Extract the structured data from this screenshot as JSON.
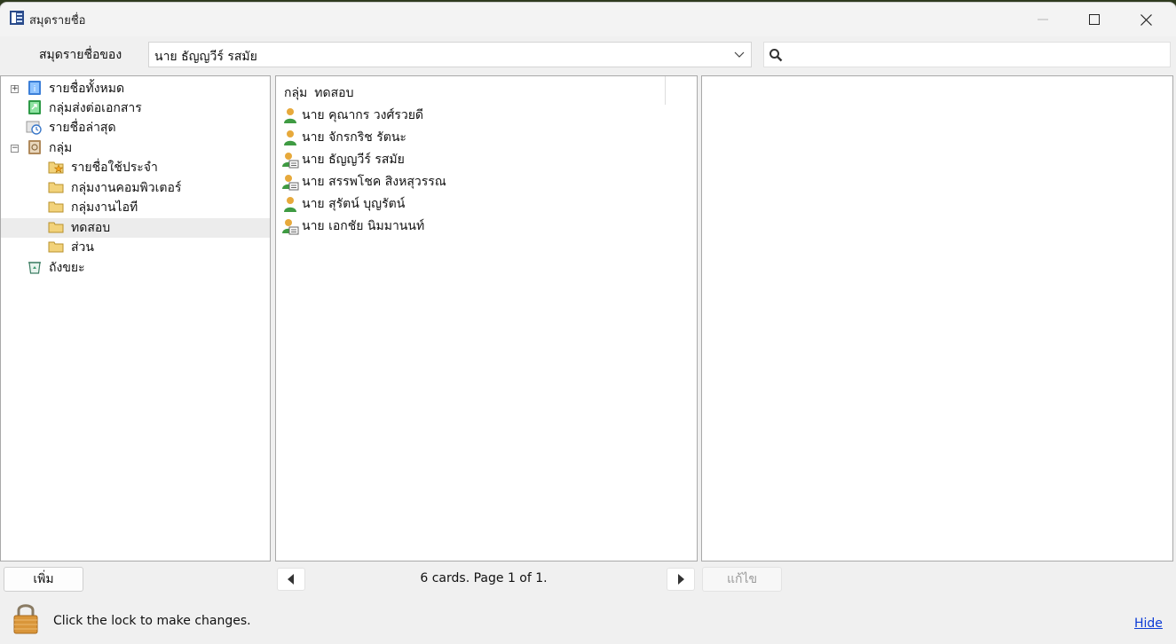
{
  "window": {
    "title": "สมุดรายชื่อ"
  },
  "toolbar": {
    "owner_label": "สมุดรายชื่อของ",
    "owner_value": "นาย ธัญญวีร์ รสมัย",
    "search_value": ""
  },
  "tree": {
    "items": [
      {
        "label": "รายชื่อทั้งหมด",
        "icon": "all-contacts-icon",
        "expander": "+"
      },
      {
        "label": "กลุ่มส่งต่อเอกสาร",
        "icon": "forward-group-icon"
      },
      {
        "label": "รายชื่อล่าสุด",
        "icon": "recent-contacts-icon"
      },
      {
        "label": "กลุ่ม",
        "icon": "groups-book-icon",
        "expander": "−"
      },
      {
        "label": "รายชื่อใช้ประจำ",
        "icon": "favorites-folder-icon"
      },
      {
        "label": "กลุ่มงานคอมพิวเตอร์",
        "icon": "folder-icon"
      },
      {
        "label": "กลุ่มงานไอที",
        "icon": "folder-icon"
      },
      {
        "label": "ทดสอบ",
        "icon": "folder-icon",
        "selected": true
      },
      {
        "label": "ส่วน",
        "icon": "folder-icon"
      },
      {
        "label": "ถังขยะ",
        "icon": "trash-icon"
      }
    ]
  },
  "list": {
    "group_label": "กลุ่ม",
    "group_name": "ทดสอบ",
    "cards": [
      {
        "name": "นาย คุณากร วงศ์รวยดี",
        "icon": "person-icon"
      },
      {
        "name": "นาย จักรกริช รัตนะ",
        "icon": "person-icon"
      },
      {
        "name": "นาย ธัญญวีร์ รสมัย",
        "icon": "person-card-icon"
      },
      {
        "name": "นาย สรรพโชค สิงหสุวรรณ",
        "icon": "person-card-icon"
      },
      {
        "name": "นาย สุรัตน์ บุญรัตน์",
        "icon": "person-icon"
      },
      {
        "name": "นาย เอกชัย นิมมานนท์",
        "icon": "person-card-icon"
      }
    ]
  },
  "footer": {
    "add_label": "เพิ่ม",
    "page_text": "6 cards. Page 1 of 1.",
    "edit_label": "แก้ไข",
    "lock_text": "Click the lock to make changes.",
    "hide_label": "Hide"
  },
  "colors": {
    "selection": "#ececec",
    "link": "#0b3bd6",
    "border": "#a9a9a9"
  }
}
